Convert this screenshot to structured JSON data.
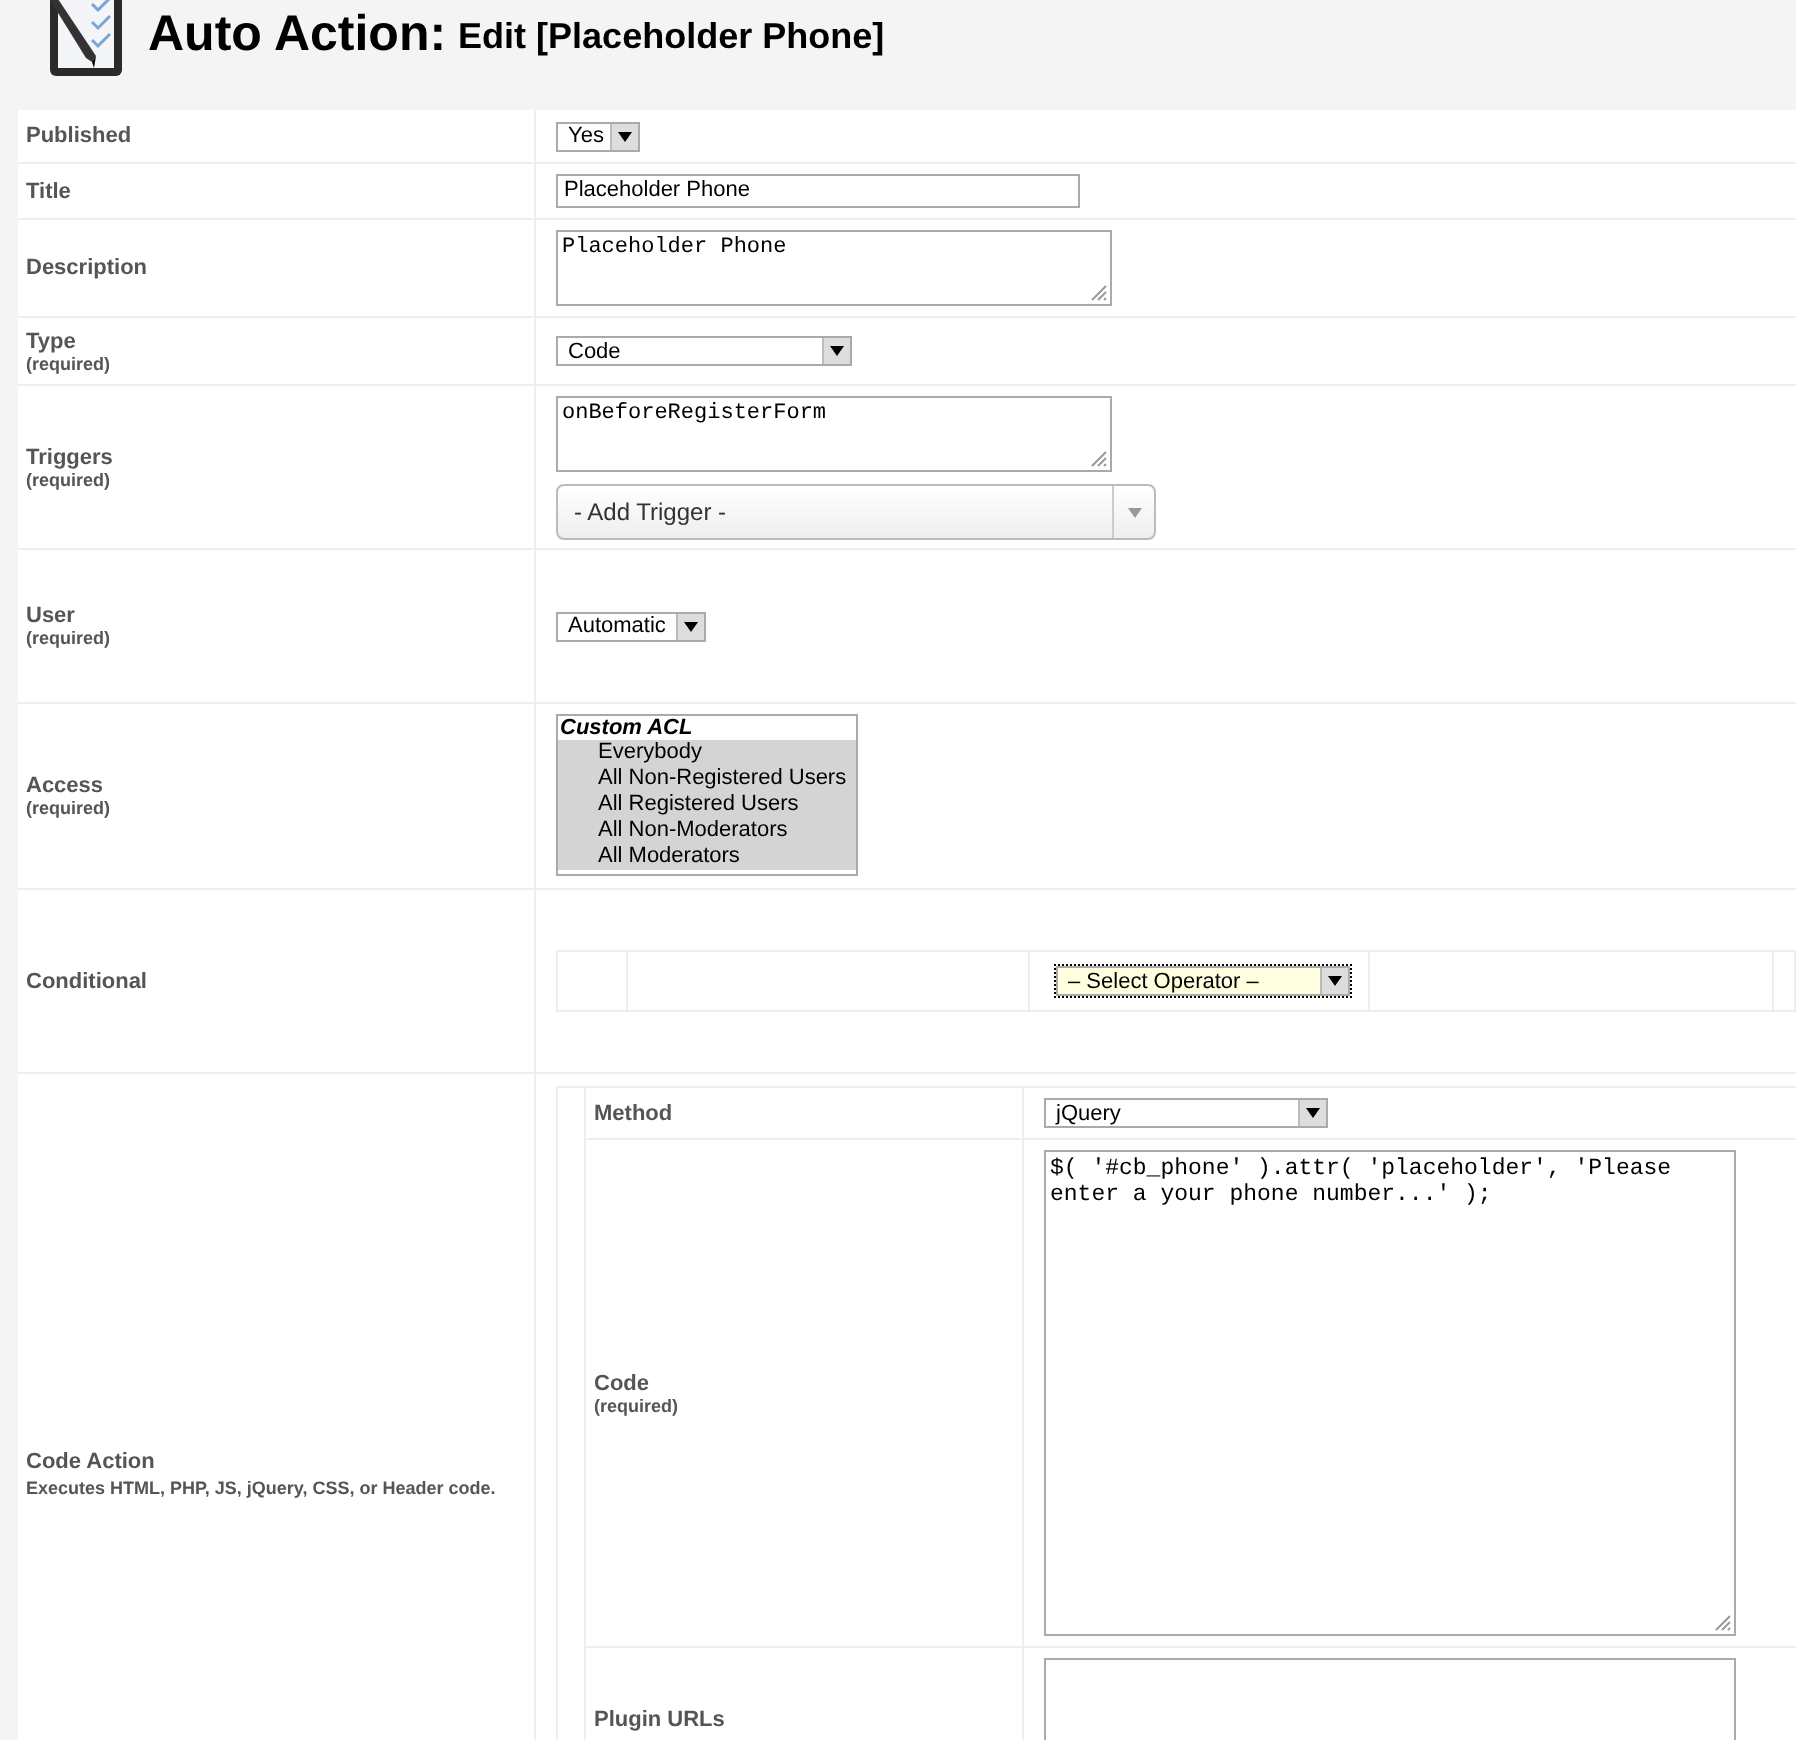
{
  "header": {
    "title": "Auto Action:",
    "subtitle": "Edit [Placeholder Phone]"
  },
  "fields": [
    {
      "kind": "select",
      "label": "Published",
      "value": "Yes"
    },
    {
      "kind": "text",
      "label": "Title",
      "value": "Placeholder Phone"
    },
    {
      "kind": "textarea",
      "label": "Description",
      "value": "Placeholder Phone"
    },
    {
      "kind": "select",
      "label": "Type",
      "required": "(required)",
      "value": "Code"
    },
    {
      "kind": "triggers",
      "label": "Triggers",
      "required": "(required)",
      "value": "onBeforeRegisterForm",
      "add_trigger": "- Add Trigger -"
    },
    {
      "kind": "select",
      "label": "User",
      "required": "(required)",
      "value": "Automatic"
    },
    {
      "kind": "listbox",
      "label": "Access",
      "required": "(required)",
      "group": "Custom ACL",
      "options": [
        {
          "label": "Everybody",
          "selected": true
        },
        {
          "label": "All Non-Registered Users",
          "selected": true
        },
        {
          "label": "All Registered Users",
          "selected": true
        },
        {
          "label": "All Non-Moderators",
          "selected": true
        },
        {
          "label": "All Moderators",
          "selected": true
        }
      ]
    },
    {
      "kind": "conditional",
      "label": "Conditional",
      "operator": {
        "value": "– Select Operator –",
        "focused": true
      }
    },
    {
      "kind": "code_action",
      "label": "Code Action",
      "description": "Executes HTML, PHP, JS, jQuery, CSS, or Header code.",
      "params": [
        {
          "kind": "select",
          "label": "Method",
          "value": "jQuery"
        },
        {
          "kind": "textarea",
          "label": "Code",
          "required": "(required)",
          "value": "$( '#cb_phone' ).attr( 'placeholder', 'Please enter a your phone number...' );"
        },
        {
          "kind": "textarea",
          "label": "Plugin URLs"
        }
      ]
    }
  ]
}
